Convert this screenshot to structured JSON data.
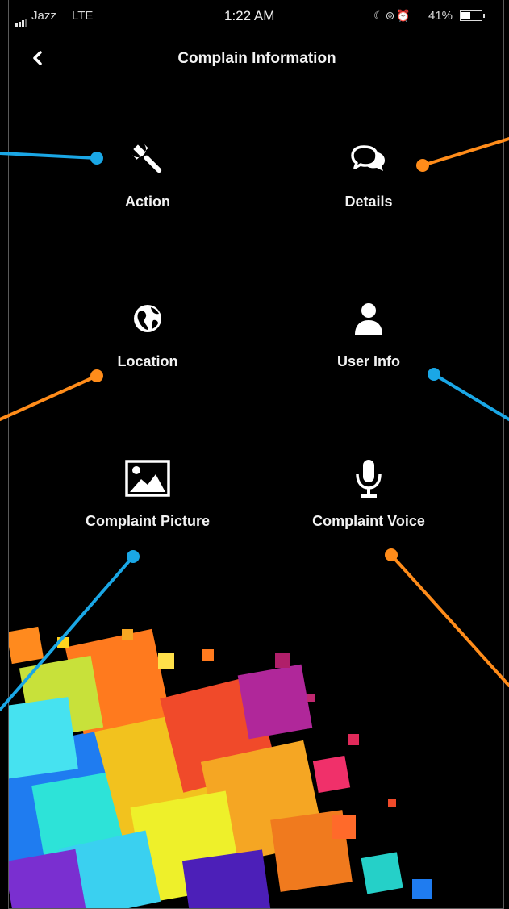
{
  "status_bar": {
    "carrier": "Jazz",
    "network": "LTE",
    "time": "1:22 AM",
    "battery_percent": "41%",
    "battery_level": 0.41,
    "icons": [
      "signal-icon",
      "moon-icon",
      "lock-rotation-icon",
      "alarm-icon",
      "battery-icon"
    ]
  },
  "header": {
    "title": "Complain Information",
    "back_icon": "chevron-left-icon"
  },
  "menu": [
    {
      "label": "Action",
      "icon": "wrench-icon"
    },
    {
      "label": "Details",
      "icon": "chat-bubbles-icon"
    },
    {
      "label": "Location",
      "icon": "globe-icon"
    },
    {
      "label": "User Info",
      "icon": "user-icon"
    },
    {
      "label": "Complaint Picture",
      "icon": "picture-icon"
    },
    {
      "label": "Complaint Voice",
      "icon": "microphone-icon"
    }
  ],
  "colors": {
    "background": "#000000",
    "text": "#f2f2f2",
    "annotation_blue": "#1aa7e6",
    "annotation_orange": "#ff8c1a"
  }
}
